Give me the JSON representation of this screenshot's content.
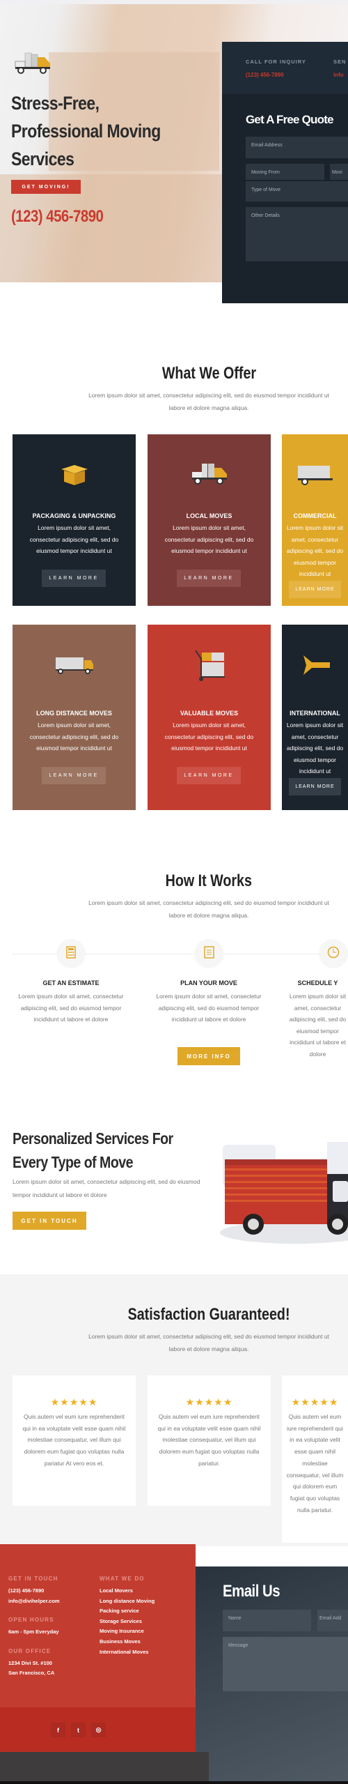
{
  "hero": {
    "title_lines": [
      "Stress-Free,",
      "Professional Moving",
      "Services"
    ],
    "cta": "GET MOVING!",
    "phone": "(123) 456-7890"
  },
  "quote": {
    "call_label": "CALL FOR INQUIRY",
    "call_value": "(123) 456-7890",
    "send_label": "SEN",
    "send_value": "info",
    "title": "Get A Free Quote",
    "email_placeholder": "Email Address",
    "from_placeholder": "Moving From",
    "to_placeholder": "Movi",
    "type_placeholder": "Type of Move",
    "details_placeholder": "Other Details"
  },
  "offer": {
    "title": "What We Offer",
    "subtitle": "Lorem ipsum dolor sit amet, consectetur adipiscing elit, sed do eiusmod tempor incididunt ut labore et dolore magna aliqua.",
    "cards": [
      {
        "title": "PACKAGING & UNPACKING",
        "text": "Lorem ipsum dolor sit amet, consectetur adipiscing elit, sed do eiusmod tempor incididunt ut",
        "button": "LEARN MORE",
        "color": "#1b232c",
        "btn": "#333e48",
        "icon": "box-icon"
      },
      {
        "title": "LOCAL MOVES",
        "text": "Lorem ipsum dolor sit amet, consectetur adipiscing elit, sed do eiusmod tempor incididunt ut",
        "button": "LEARN MORE",
        "color": "#7a3a37",
        "btn": "#8d4e4b",
        "icon": "moving-truck-icon"
      },
      {
        "title": "COMMERCIAL",
        "text": "Lorem ipsum dolor sit amet, consectetur adipiscing elit, sed do eiusmod tempor incididunt ut",
        "button": "LEARN MORE",
        "color": "#e0a828",
        "btn": "#e5b443",
        "icon": "van-icon"
      },
      {
        "title": "LONG DISTANCE MOVES",
        "text": "Lorem ipsum dolor sit amet, consectetur adipiscing elit, sed do eiusmod tempor incididunt ut",
        "button": "LEARN MORE",
        "color": "#8e6450",
        "btn": "#9c7563",
        "icon": "lorry-icon"
      },
      {
        "title": "VALUABLE MOVES",
        "text": "Lorem ipsum dolor sit amet, consectetur adipiscing elit, sed do eiusmod tempor incididunt ut",
        "button": "LEARN MORE",
        "color": "#c33c30",
        "btn": "#cc5247",
        "icon": "cart-icon"
      },
      {
        "title": "INTERNATIONAL",
        "text": "Lorem ipsum dolor sit amet, consectetur adipiscing elit, sed do eiusmod tempor incididunt ut",
        "button": "LEARN MORE",
        "color": "#1b232c",
        "btn": "#333e48",
        "icon": "airplane-icon"
      }
    ]
  },
  "how": {
    "title": "How It Works",
    "subtitle": "Lorem ipsum dolor sit amet, consectetur adipiscing elit, sed do eiusmod tempor incididunt ut labore et dolore magna aliqua.",
    "steps": [
      {
        "title": "GET AN ESTIMATE",
        "text": "Lorem ipsum dolor sit amet, consectetur adipiscing elit, sed do eiusmod tempor incididunt ut labore et dolore",
        "icon": "calculator-icon"
      },
      {
        "title": "PLAN YOUR MOVE",
        "text": "Lorem ipsum dolor sit amet, consectetur adipiscing elit, sed do eiusmod tempor incididunt ut labore et dolore",
        "icon": "document-icon"
      },
      {
        "title": "SCHEDULE Y",
        "text": "Lorem ipsum dolor sit amet, consectetur adipiscing elit, sed do eiusmod tempor incididunt ut labore et dolore",
        "icon": "clock-icon"
      }
    ],
    "button": "MORE INFO"
  },
  "personal": {
    "title_lines": [
      "Personalized Services For",
      "Every Type of Move"
    ],
    "text": "Lorem ipsum dolor sit amet, consectetur adipiscing elit, sed do eiusmod tempor incididunt ut labore et dolore",
    "button": "GET IN TOUCH"
  },
  "satisfaction": {
    "title": "Satisfaction Guaranteed!",
    "subtitle": "Lorem ipsum dolor sit amet, consectetur adipiscing elit, sed do eiusmod tempor incididunt ut labore et dolore magna aliqua.",
    "testimonials": [
      {
        "stars": 5,
        "text": "Quis autem vel eum iure reprehenderit qui in ea voluptate velit esse quam nihil molestiae consequatur, vel illum qui dolorem eum fugiat quo voluptas nulla pariatur At vero eos et."
      },
      {
        "stars": 5,
        "text": "Quis autem vel eum iure reprehenderit qui in ea voluptate velit esse quam nihil molestiae consequatur, vel illum qui dolorem eum fugiat quo voluptas nulla pariatur."
      },
      {
        "stars": 5,
        "text": "Quis autem vel eum iure reprehenderit qui in ea voluptate velit esse quam nihil molestiae consequatur, vel illum qui dolorem eum fugiat quo voluptas nulla pariatur."
      }
    ]
  },
  "footer": {
    "touch_label": "GET IN TOUCH",
    "phone": "(123) 456-7890",
    "email": "info@divihelper.com",
    "hours_label": "OPEN HOURS",
    "hours": "6am - 5pm Everyday",
    "office_label": "OUR OFFICE",
    "address1": "1234 Divi St. #100",
    "address2": "San Francisco, CA",
    "what_label": "WHAT WE DO",
    "links": [
      "Local Movers",
      "Long distance Moving",
      "Packing service",
      "Storage Services",
      "Moving Insurance",
      "Business Moves",
      "International Moves"
    ],
    "social": [
      {
        "icon": "facebook-icon",
        "glyph": "f"
      },
      {
        "icon": "twitter-icon",
        "glyph": "t"
      },
      {
        "icon": "instagram-icon",
        "glyph": "◎"
      }
    ]
  },
  "email_us": {
    "title": "Email Us",
    "name_placeholder": "Name",
    "email_placeholder": "Email Add",
    "message_placeholder": "Message"
  }
}
